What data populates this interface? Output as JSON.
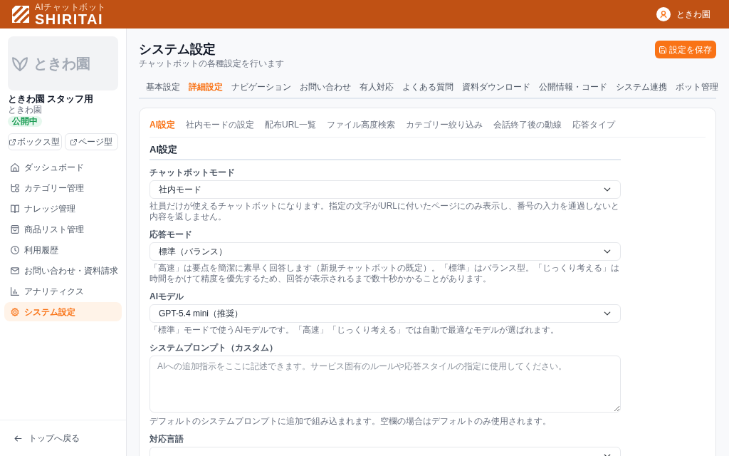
{
  "header": {
    "logo_tagline": "AIチャットボット",
    "logo_text": "SHIRITAI",
    "user_name": "ときわ園"
  },
  "sidebar": {
    "bot": {
      "thumbnail_text": "ときわ園",
      "name": "ときわ園 スタッフ用",
      "owner": "ときわ園",
      "status": "公開中"
    },
    "preview_buttons": [
      "ボックス型",
      "ページ型"
    ],
    "items": [
      {
        "label": "ダッシュボード",
        "selected": false
      },
      {
        "label": "カテゴリー管理",
        "selected": false
      },
      {
        "label": "ナレッジ管理",
        "selected": false
      },
      {
        "label": "商品リスト管理",
        "selected": false
      },
      {
        "label": "利用履歴",
        "selected": false
      },
      {
        "label": "お問い合わせ・資料請求",
        "selected": false
      },
      {
        "label": "アナリティクス",
        "selected": false
      },
      {
        "label": "システム設定",
        "selected": true
      }
    ],
    "back_link": "トップへ戻る"
  },
  "page": {
    "title": "システム設定",
    "subtitle": "チャットボットの各種設定を行います",
    "save_button": "設定を保存"
  },
  "tabs": [
    {
      "label": "基本設定",
      "selected": false
    },
    {
      "label": "詳細設定",
      "selected": true
    },
    {
      "label": "ナビゲーション",
      "selected": false
    },
    {
      "label": "お問い合わせ",
      "selected": false
    },
    {
      "label": "有人対応",
      "selected": false
    },
    {
      "label": "よくある質問",
      "selected": false
    },
    {
      "label": "資料ダウンロード",
      "selected": false
    },
    {
      "label": "公開情報・コード",
      "selected": false
    },
    {
      "label": "システム連携",
      "selected": false
    },
    {
      "label": "ボット管理",
      "selected": false
    }
  ],
  "sub_tabs": [
    {
      "label": "AI設定",
      "selected": true
    },
    {
      "label": "社内モードの設定",
      "selected": false
    },
    {
      "label": "配布URL一覧",
      "selected": false
    },
    {
      "label": "ファイル高度検索",
      "selected": false
    },
    {
      "label": "カテゴリー絞り込み",
      "selected": false
    },
    {
      "label": "会話終了後の動線",
      "selected": false
    },
    {
      "label": "応答タイプ",
      "selected": false
    }
  ],
  "section_title": "AI設定",
  "fields": [
    {
      "kind": "select",
      "label": "チャットボットモード",
      "value": "社内モード",
      "help": "社員だけが使えるチャットボットになります。指定の文字がURLに付いたページにのみ表示し、番号の入力を通過しないと内容を返しません。"
    },
    {
      "kind": "select",
      "label": "応答モード",
      "value": "標準（バランス）",
      "help": "「高速」は要点を簡潔に素早く回答します（新規チャットボットの既定）。「標準」はバランス型。「じっくり考える」は時間をかけて精度を優先するため、回答が表示されるまで数十秒かかることがあります。"
    },
    {
      "kind": "select",
      "label": "AIモデル",
      "value": "GPT-5.4 mini（推奨）",
      "help": "「標準」モードで使うAIモデルです。「高速」「じっくり考える」では自動で最適なモデルが選ばれます。"
    },
    {
      "kind": "textarea",
      "label": "システムプロンプト（カスタム）",
      "placeholder": "AIへの追加指示をここに記述できます。サービス固有のルールや応答スタイルの指定に使用してください。",
      "help": "デフォルトのシステムプロンプトに追加で組み込まれます。空欄の場合はデフォルトのみ使用されます。"
    },
    {
      "kind": "select",
      "label": "対応言語"
    }
  ]
}
